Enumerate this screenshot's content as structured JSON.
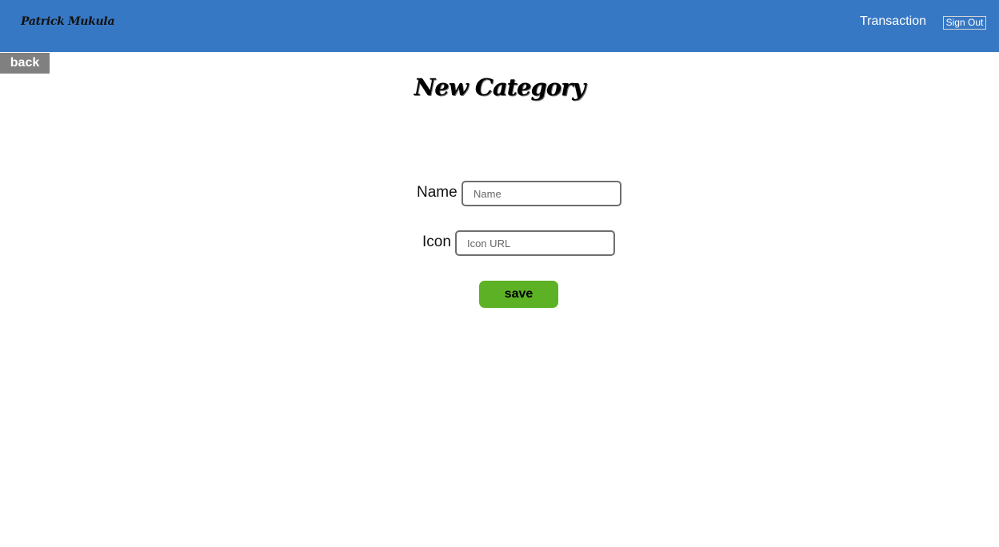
{
  "navbar": {
    "brand": "Patrick Mukula",
    "transaction_link": "Transaction",
    "sign_out_label": "Sign Out",
    "background_color": "#3778c4"
  },
  "back_button": {
    "label": "back"
  },
  "page": {
    "title": "New Category"
  },
  "form": {
    "name_label": "Name",
    "name_placeholder": "Name",
    "name_value": "",
    "icon_label": "Icon",
    "icon_placeholder": "Icon URL",
    "icon_value": "",
    "save_label": "save",
    "save_color": "#5cb224"
  }
}
